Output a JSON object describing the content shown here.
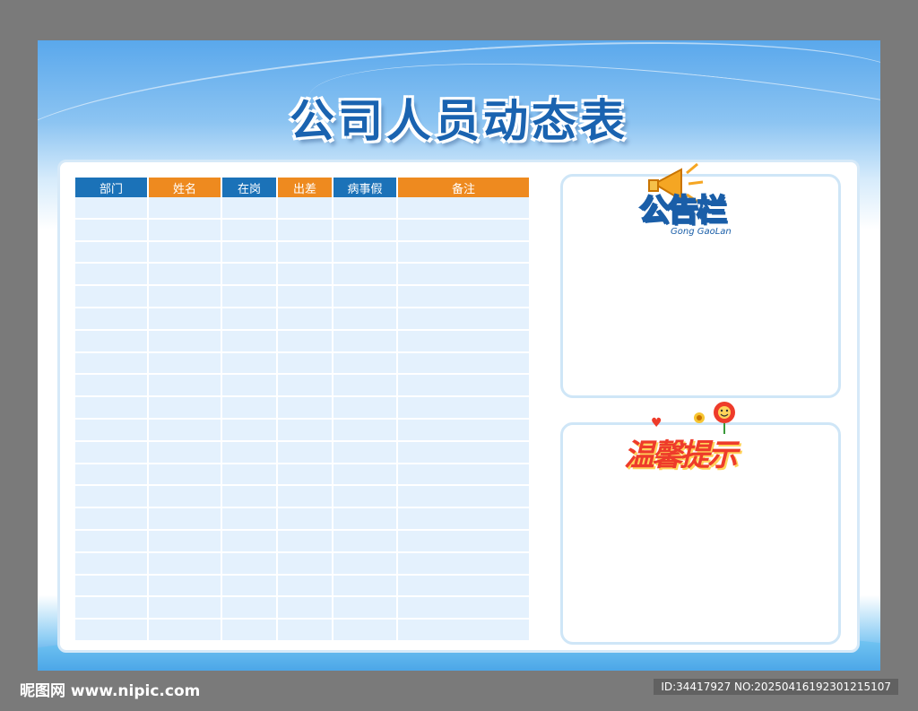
{
  "board": {
    "title": "公司人员动态表"
  },
  "roster": {
    "headers": [
      {
        "label": "部门",
        "color": "#1b72b8"
      },
      {
        "label": "姓名",
        "color": "#ee8a1f"
      },
      {
        "label": "在岗",
        "color": "#1b72b8"
      },
      {
        "label": "出差",
        "color": "#ee8a1f"
      },
      {
        "label": "病事假",
        "color": "#1b72b8"
      },
      {
        "label": "备注",
        "color": "#ee8a1f"
      }
    ],
    "row_count": 20
  },
  "notice": {
    "title": "公告栏",
    "subtitle": "Gong GaoLan",
    "icon": "megaphone-icon"
  },
  "tips": {
    "title": "温馨提示",
    "icon": "flower-icon"
  },
  "watermark": {
    "left": "昵图网 www.nipic.com",
    "right": "ID:34417927 NO:20250416192301215107"
  },
  "colors": {
    "accent_blue": "#1b72b8",
    "accent_orange": "#ee8a1f",
    "cell_fill": "#e4f1fd"
  }
}
